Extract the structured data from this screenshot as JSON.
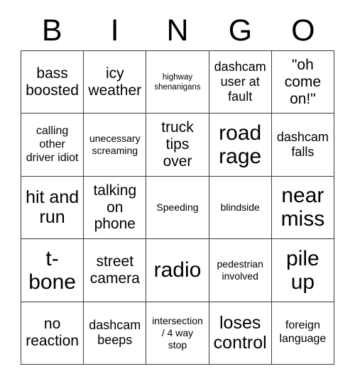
{
  "card": {
    "title": "BINGO",
    "header_letters": [
      "B",
      "I",
      "N",
      "G",
      "O"
    ],
    "columns": 5,
    "rows": 5,
    "border_color": "#3a3a3a",
    "background_color": "#ffffff",
    "text_color": "#000000",
    "cells": [
      [
        {
          "text": "bass\nboosted",
          "size": "xl"
        },
        {
          "text": "icy\nweather",
          "size": "xl"
        },
        {
          "text": "highway\nshenanigans",
          "size": "xs"
        },
        {
          "text": "dashcam\nuser at\nfault",
          "size": "lg"
        },
        {
          "text": "\"oh\ncome\non!\"",
          "size": "xl"
        }
      ],
      [
        {
          "text": "calling\nother\ndriver idiot",
          "size": "md"
        },
        {
          "text": "unecessary\nscreaming",
          "size": "sm"
        },
        {
          "text": "truck\ntips\nover",
          "size": "xl"
        },
        {
          "text": "road\nrage",
          "size": "huge"
        },
        {
          "text": "dashcam\nfalls",
          "size": "lg"
        }
      ],
      [
        {
          "text": "hit and\nrun",
          "size": "xxl"
        },
        {
          "text": "talking\non\nphone",
          "size": "xl"
        },
        {
          "text": "Speeding",
          "size": "sm"
        },
        {
          "text": "blindside",
          "size": "sm"
        },
        {
          "text": "near\nmiss",
          "size": "huge"
        }
      ],
      [
        {
          "text": "t-\nbone",
          "size": "huge"
        },
        {
          "text": "street\ncamera",
          "size": "xl"
        },
        {
          "text": "radio",
          "size": "huge"
        },
        {
          "text": "pedestrian\ninvolved",
          "size": "sm"
        },
        {
          "text": "pile\nup",
          "size": "huge"
        }
      ],
      [
        {
          "text": "no\nreaction",
          "size": "xl"
        },
        {
          "text": "dashcam\nbeeps",
          "size": "lg"
        },
        {
          "text": "intersection\n/ 4 way\nstop",
          "size": "sm"
        },
        {
          "text": "loses\ncontrol",
          "size": "xxl"
        },
        {
          "text": "foreign\nlanguage",
          "size": "md"
        }
      ]
    ]
  }
}
